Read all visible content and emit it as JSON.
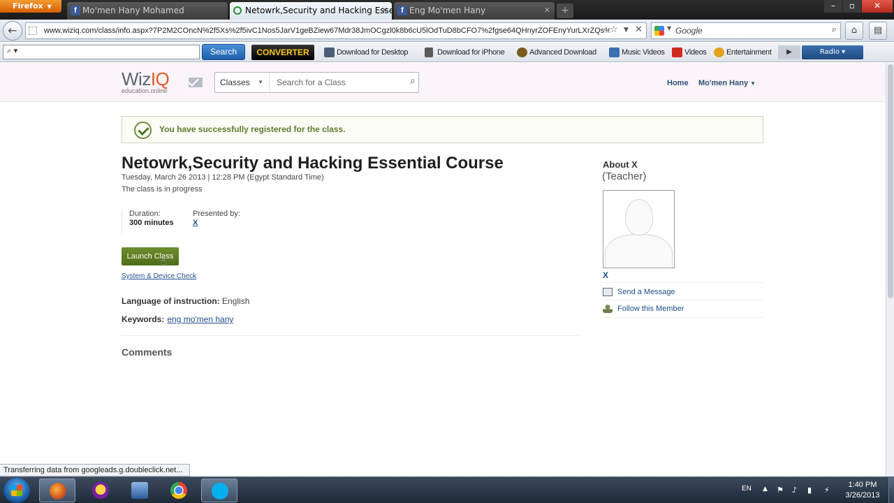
{
  "browser": {
    "app_button": "Firefox",
    "tabs": [
      {
        "label": "Mo'men Hany Mohamed",
        "favicon": "f"
      },
      {
        "label": "Netowrk,Security and Hacking Essent...",
        "favicon": ""
      },
      {
        "label": "Eng Mo'men Hany",
        "favicon": "f"
      }
    ],
    "new_tab": "+",
    "url": "www.wiziq.com/class/info.aspx?7P2M2COncN%2f5Xs%2f5ivC1Nos5JarV1geBZiew67Mdr38JmOCgzl0k8b6cU5lOdTuD8bCFO7%2fgse64QHnyrZOFEnyYurLXrZQs%2",
    "search_engine": "Google"
  },
  "toolbar": {
    "search_button": "Search",
    "converter_label": "VIDEO DOWNLOAD CONVERTER",
    "items": [
      {
        "label": "Download for Desktop",
        "color": "#4a5d7a"
      },
      {
        "label": "Download for iPhone",
        "color": "#5b5b5b"
      },
      {
        "label": "Advanced Download",
        "color": "#7a5a20"
      },
      {
        "label": "Music Videos",
        "color": "#3b6fb0"
      },
      {
        "label": "Videos",
        "color": "#d12a1f"
      },
      {
        "label": "Entertainment",
        "color": "#e0a21c"
      }
    ],
    "radio_label": "Radio"
  },
  "site": {
    "logo": {
      "wiz": "Wiz",
      "iq": "IQ",
      "tagline": "education.online"
    },
    "search_category": "Classes",
    "search_placeholder": "Search for a Class",
    "nav_home": "Home",
    "nav_user": "Mo'men Hany",
    "success_message": "You have successfully registered for the class."
  },
  "course": {
    "title": "Netowrk,Security and Hacking Essential Course",
    "datetime": "Tuesday, March 26 2013 | 12:28 PM (Egypt Standard Time)",
    "status": "The class is in progress",
    "duration_label": "Duration:",
    "duration_value": "300 minutes",
    "presenter_label": "Presented by:",
    "presenter_value": "X",
    "launch_button": "Launch Class",
    "system_check": "System & Device Check",
    "language_label": "Language of instruction:",
    "language_value": "English",
    "keywords_label": "Keywords:",
    "keywords_value": "eng mo'men hany",
    "comments_heading": "Comments"
  },
  "teacher": {
    "about_heading": "About X",
    "role": "(Teacher)",
    "name_link": "X",
    "send_message": "Send a Message",
    "follow": "Follow this Member"
  },
  "status_bar": "Transferring data from googleads.g.doubleclick.net...",
  "taskbar": {
    "language": "EN",
    "time": "1:40 PM",
    "date": "3/26/2013"
  }
}
